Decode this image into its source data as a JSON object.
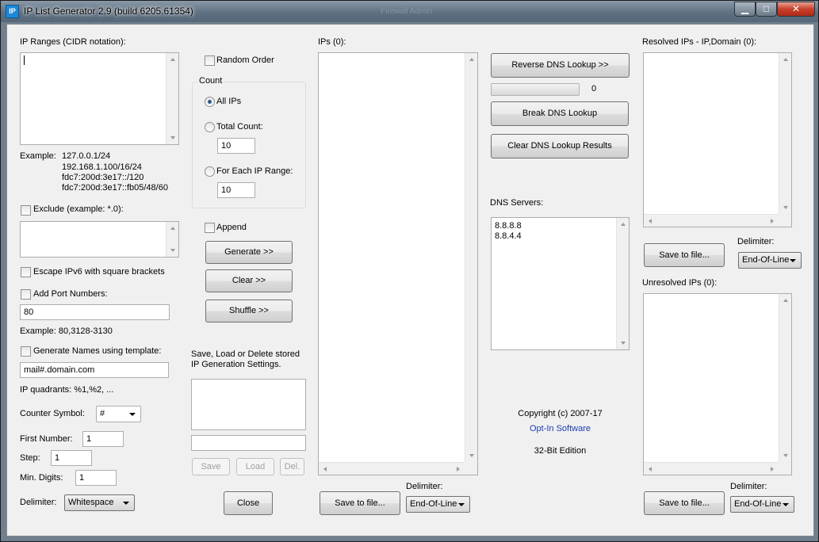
{
  "window": {
    "title": "IP List Generator 2.9 (build 6205.61354)",
    "ghost_title": "Firewall Admin",
    "icon_text": "IP",
    "colors": {
      "accent": "#1e88d8",
      "close": "#c8402a",
      "link": "#1a3fb0"
    }
  },
  "left": {
    "ip_ranges_label": "IP Ranges (CIDR notation):",
    "ip_ranges_value": "",
    "example_label": "Example:",
    "example_lines": [
      "127.0.0.1/24",
      "192.168.1.100/16/24",
      "fdc7:200d:3e17::/120",
      "fdc7:200d:3e17::fb05/48/60"
    ],
    "exclude_label": "Exclude (example: *.0):",
    "exclude_checked": false,
    "exclude_value": "",
    "escape_ipv6_label": "Escape IPv6 with square brackets",
    "escape_ipv6_checked": false,
    "add_port_label": "Add Port Numbers:",
    "add_port_checked": false,
    "port_value": "80",
    "port_example": "Example: 80,3128-3130",
    "gen_names_label": "Generate Names using template:",
    "gen_names_checked": false,
    "template_value": "mail#.domain.com",
    "quadrants_text": "IP quadrants: %1,%2,  ...",
    "counter_symbol_label": "Counter Symbol:",
    "counter_symbol_value": "#",
    "first_number_label": "First Number:",
    "first_number_value": "1",
    "step_label": "Step:",
    "step_value": "1",
    "min_digits_label": "Min. Digits:",
    "min_digits_value": "1",
    "delimiter_label": "Delimiter:",
    "delimiter_value": "Whitespace"
  },
  "middle": {
    "random_order_label": "Random Order",
    "random_order_checked": false,
    "count_group_label": "Count",
    "all_ips_label": "All IPs",
    "total_count_label": "Total Count:",
    "total_count_value": "10",
    "for_each_label": "For Each IP Range:",
    "for_each_value": "10",
    "selected_count_option": "All IPs",
    "append_label": "Append",
    "append_checked": false,
    "generate_button": "Generate >>",
    "clear_button": "Clear >>",
    "shuffle_button": "Shuffle >>",
    "settings_label_line1": "Save, Load or Delete stored",
    "settings_label_line2": "IP Generation Settings.",
    "settings_name_value": "",
    "save_button": "Save",
    "load_button": "Load",
    "delete_button": "Del.",
    "close_button": "Close"
  },
  "ips": {
    "label": "IPs (0):",
    "save_button": "Save to file...",
    "delimiter_label": "Delimiter:",
    "delimiter_value": "End-Of-Line"
  },
  "dns": {
    "reverse_button": "Reverse DNS Lookup >>",
    "progress_value": "0",
    "progress_fraction": 0,
    "break_button": "Break DNS Lookup",
    "clear_results_button": "Clear DNS Lookup Results",
    "servers_label": "DNS Servers:",
    "servers": [
      "8.8.8.8",
      "8.8.4.4"
    ],
    "copyright": "Copyright (c) 2007-17",
    "company_link": "Opt-In Software",
    "edition": "32-Bit Edition"
  },
  "resolved": {
    "label": "Resolved IPs - IP,Domain (0):",
    "save_button": "Save to file...",
    "delimiter_label": "Delimiter:",
    "delimiter_value": "End-Of-Line"
  },
  "unresolved": {
    "label": "Unresolved IPs (0):",
    "save_button": "Save to file...",
    "delimiter_label": "Delimiter:",
    "delimiter_value": "End-Of-Line"
  }
}
